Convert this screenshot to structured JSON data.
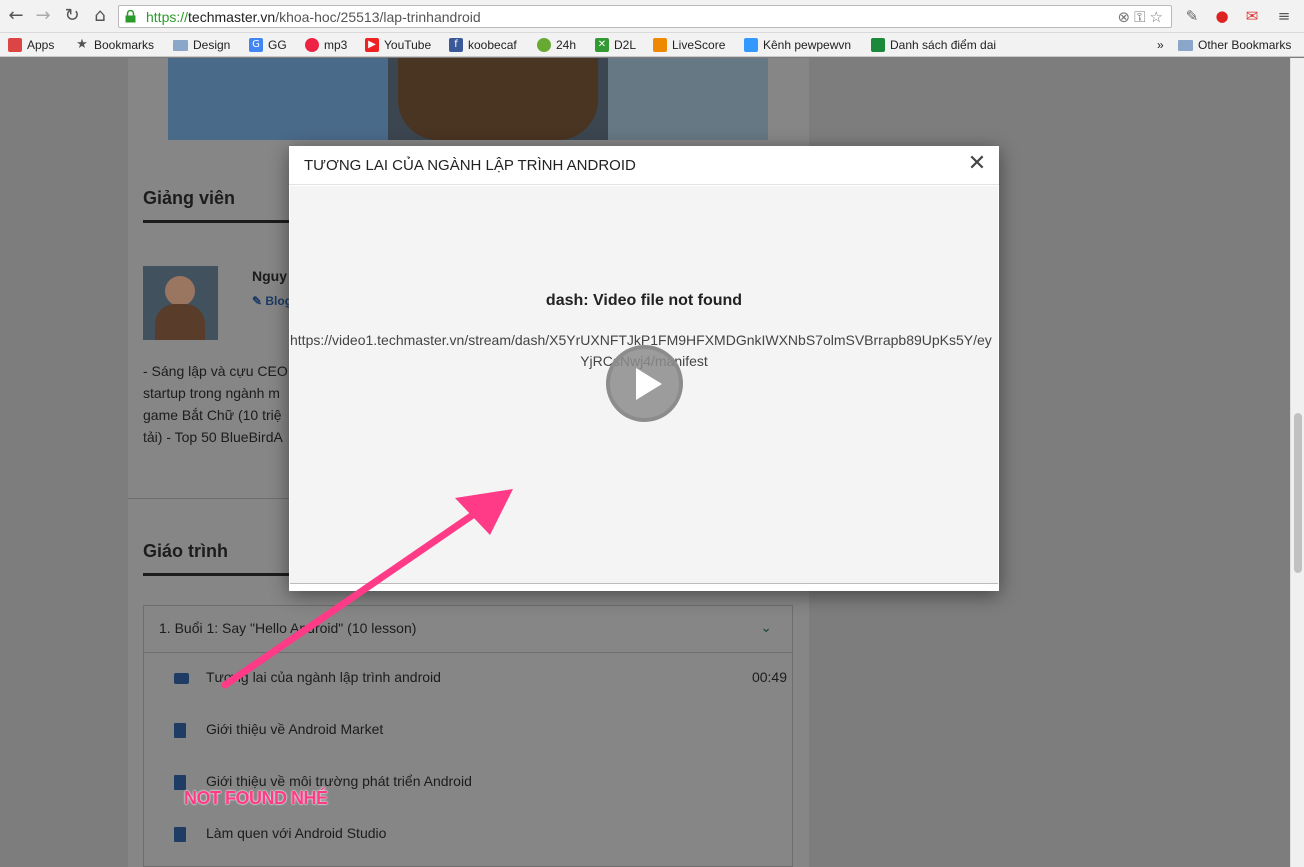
{
  "browser": {
    "url_scheme": "https://",
    "url_host": "techmaster.vn",
    "url_path": "/khoa-hoc/25513/lap-trinhandroid",
    "bookmarks": [
      {
        "label": "Apps",
        "icon": "apps-grid-icon",
        "color": "#d44"
      },
      {
        "label": "Bookmarks",
        "icon": "star-icon",
        "color": "#555"
      },
      {
        "label": "Design",
        "icon": "folder-icon",
        "color": "#8aa6c8"
      },
      {
        "label": "GG",
        "icon": "google-icon",
        "color": "#4285f4"
      },
      {
        "label": "mp3",
        "icon": "mp3-icon",
        "color": "#e24"
      },
      {
        "label": "YouTube",
        "icon": "youtube-icon",
        "color": "#e22"
      },
      {
        "label": "koobecaf",
        "icon": "facebook-icon",
        "color": "#3b5998"
      },
      {
        "label": "24h",
        "icon": "24h-icon",
        "color": "#6a3"
      },
      {
        "label": "D2L",
        "icon": "d2l-icon",
        "color": "#393"
      },
      {
        "label": "LiveScore",
        "icon": "livescore-icon",
        "color": "#e80"
      },
      {
        "label": "Kênh pewpewvn",
        "icon": "channel-icon",
        "color": "#39f"
      },
      {
        "label": "Danh sách điểm dai",
        "icon": "sheet-icon",
        "color": "#1a8a3a"
      }
    ],
    "overflow": "»",
    "other_bookmarks": "Other Bookmarks"
  },
  "page": {
    "instructor_heading": "Giảng viên",
    "instructor_name": "Nguy",
    "instructor_blog": "Blog",
    "bio_lines": [
      "- Sáng lập và cựu CEO",
      "startup trong ngành m",
      "game Bắt Chữ (10 triệ",
      "tải) - Top 50 BlueBirdA"
    ],
    "curriculum_heading": "Giáo trình",
    "section_label": "1. Buổi 1: Say \"Hello Android\" (10 lesson)",
    "lessons": [
      {
        "label": "Tương lai của ngành lập trình android",
        "duration": "00:49",
        "type": "video"
      },
      {
        "label": "Giới thiệu về Android Market",
        "duration": "",
        "type": "doc"
      },
      {
        "label": "Giới thiệu về môi trường phát triển Android",
        "duration": "",
        "type": "doc"
      },
      {
        "label": "Làm quen với Android Studio",
        "duration": "",
        "type": "doc"
      }
    ]
  },
  "modal": {
    "title": "TƯƠNG LAI CỦA NGÀNH LẬP TRÌNH ANDROID",
    "close_glyph": "✕",
    "error_title": "dash: Video file not found",
    "error_url_line1": "https://video1.techmaster.vn/stream/dash/X5YrUXNFTJkP1FM9HFXMDGnkIWXNbS7olmSVBrrapb89UpKs5Y/ey",
    "error_url_line2": "YjRCsNwj4/manifest"
  },
  "annotation": {
    "note": "NOT FOUND NHÉ",
    "color": "#ff3a86"
  }
}
